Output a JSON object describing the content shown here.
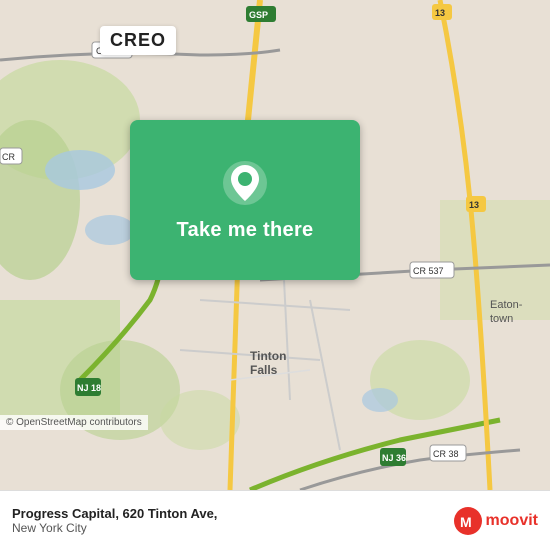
{
  "header": {
    "creo_label": "CREO"
  },
  "map": {
    "copyright_text": "© OpenStreetMap contributors"
  },
  "overlay": {
    "button_label": "Take me there",
    "pin_icon": "location-pin"
  },
  "bottom_bar": {
    "location_name": "Progress Capital, 620 Tinton Ave,",
    "location_city": "New York City",
    "moovit_brand": "moovit"
  }
}
